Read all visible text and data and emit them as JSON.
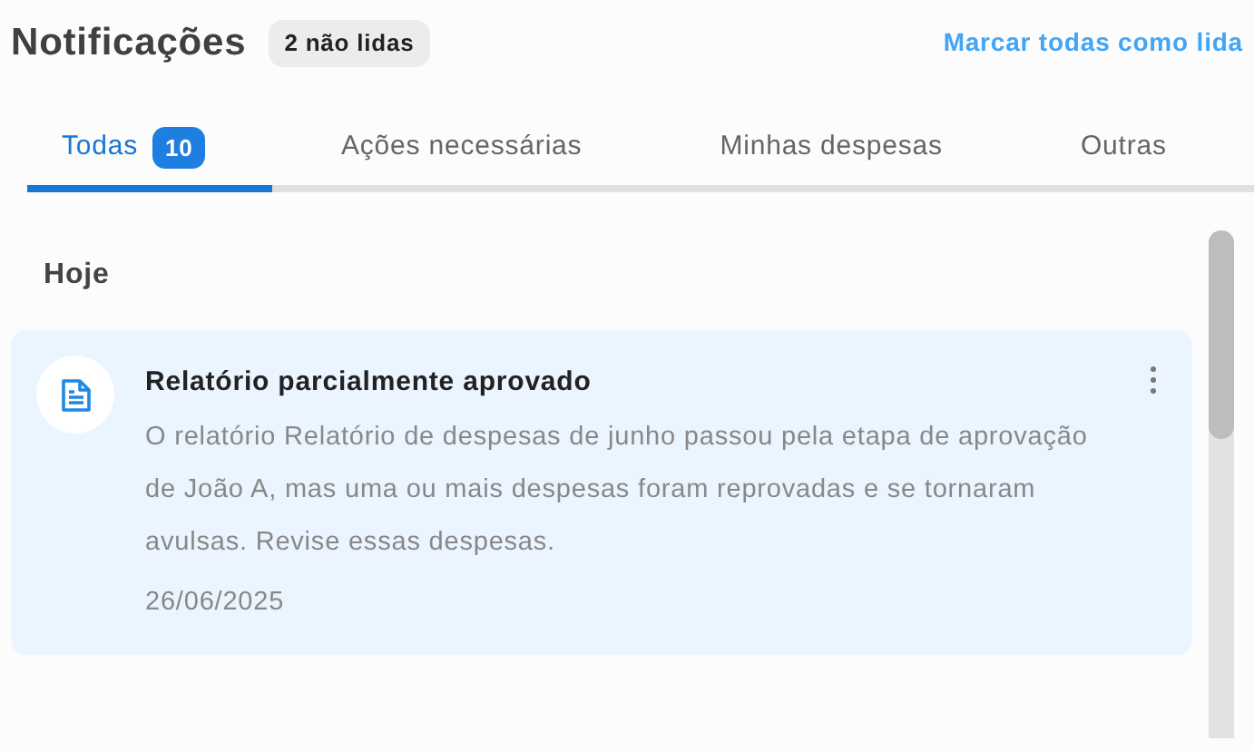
{
  "header": {
    "title": "Notificações",
    "unread_badge": "2 não lidas",
    "mark_all": "Marcar todas como lida"
  },
  "tabs": [
    {
      "label": "Todas",
      "count": "10",
      "selected": true
    },
    {
      "label": "Ações necessárias",
      "selected": false
    },
    {
      "label": "Minhas despesas",
      "selected": false
    },
    {
      "label": "Outras",
      "selected": false
    }
  ],
  "sections": [
    {
      "heading": "Hoje",
      "notifications": [
        {
          "title": "Relatório parcialmente aprovado",
          "body": "O relatório Relatório de despesas de junho passou pela etapa de aprovação de João A, mas uma ou mais despesas foram reprovadas e se tornaram avulsas. Revise essas despesas.",
          "date": "26/06/2025",
          "unread": true
        }
      ]
    }
  ]
}
